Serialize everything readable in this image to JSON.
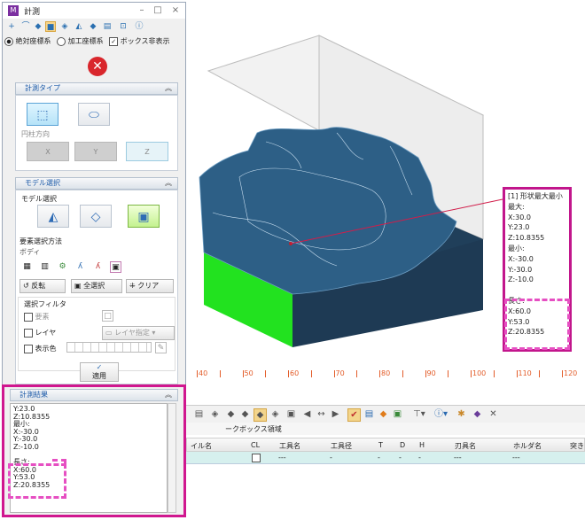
{
  "dialog": {
    "title": "計測",
    "radio_absolute": "絶対座標系",
    "radio_machining": "加工座標系",
    "box_hide": "ボックス非表示",
    "section_type": "計測タイプ",
    "cylinder_dir": "円柱方向",
    "axis_x": "X",
    "axis_y": "Y",
    "axis_z": "Z",
    "section_model": "モデル選択",
    "model_select": "モデル選択",
    "element_method": "要素選択方法",
    "body_value": "ボディ",
    "btn_reverse": "反転",
    "btn_select_all": "全選択",
    "btn_clear": "クリア",
    "filter": "選択フィルタ",
    "filter_element": "要素",
    "filter_layer": "レイヤ",
    "filter_color": "表示色",
    "layer_dropdown": "レイヤ指定",
    "apply": "適用"
  },
  "results": {
    "title": "計測結果",
    "lines": [
      "Y:23.0",
      "Z:10.8355",
      "最小:",
      "X:-30.0",
      "Y:-30.0",
      "Z:-10.0",
      "",
      "長さ:",
      "X:60.0",
      "Y:53.0",
      "Z:20.8355"
    ]
  },
  "callout": {
    "lines": [
      "[1] 形状最大最小",
      "最大:",
      "X:30.0",
      "Y:23.0",
      "Z:10.8355",
      "最小:",
      "X:-30.0",
      "Y:-30.0",
      "Z:-10.0",
      "",
      "長さ:",
      "X:60.0",
      "Y:53.0",
      "Z:20.8355"
    ]
  },
  "ruler": {
    "ticks": [
      "40",
      "50",
      "60",
      "70",
      "80",
      "90",
      "100",
      "110",
      "120"
    ]
  },
  "table": {
    "tab_label": "ークボックス領域",
    "headers": [
      "イル名",
      "CL",
      "工具名",
      "工具径",
      "T",
      "D",
      "H",
      "刃具名",
      "ホルダ名",
      "突き"
    ],
    "row": [
      "",
      "",
      "---",
      "-",
      "-",
      "-",
      "-",
      "---",
      "---",
      ""
    ]
  },
  "colors": {
    "accent": "#d0178f",
    "model_blue": "#2d5f86",
    "green_face": "#19e31f",
    "ruler": "#e35d2a"
  }
}
